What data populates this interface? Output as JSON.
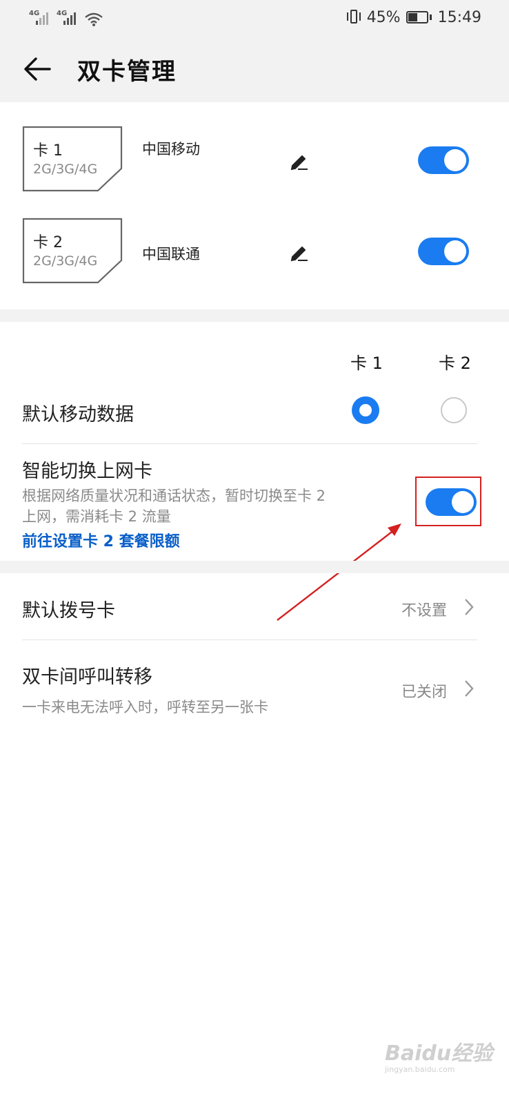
{
  "status_bar": {
    "signal1_label": "4G",
    "signal2_label": "4G",
    "battery_percent": "45%",
    "time": "15:49"
  },
  "header": {
    "title": "双卡管理"
  },
  "sims": [
    {
      "name": "卡 1",
      "network": "2G/3G/4G",
      "carrier": "中国移动",
      "enabled": true
    },
    {
      "name": "卡 2",
      "network": "2G/3G/4G",
      "carrier": "中国联通",
      "enabled": true
    }
  ],
  "data_section": {
    "col1": "卡 1",
    "col2": "卡 2",
    "default_data_label": "默认移动数据",
    "selected_card": "卡 1",
    "smart_switch": {
      "title": "智能切换上网卡",
      "desc_line1": "根据网络质量状况和通话状态，暂时切换至卡 2",
      "desc_line2": "上网，需消耗卡 2 流量",
      "link": "前往设置卡 2 套餐限额",
      "enabled": true
    }
  },
  "call_section": {
    "default_dial_label": "默认拨号卡",
    "default_dial_value": "不设置",
    "forward_label": "双卡间呼叫转移",
    "forward_desc": "一卡来电无法呼入时，呼转至另一张卡",
    "forward_value": "已关闭"
  },
  "watermark": {
    "text": "Baidu经验",
    "sub": "jingyan.baidu.com"
  },
  "colors": {
    "accent": "#1a7cf0",
    "link": "#0a5fc8",
    "annotation": "#d42020"
  }
}
